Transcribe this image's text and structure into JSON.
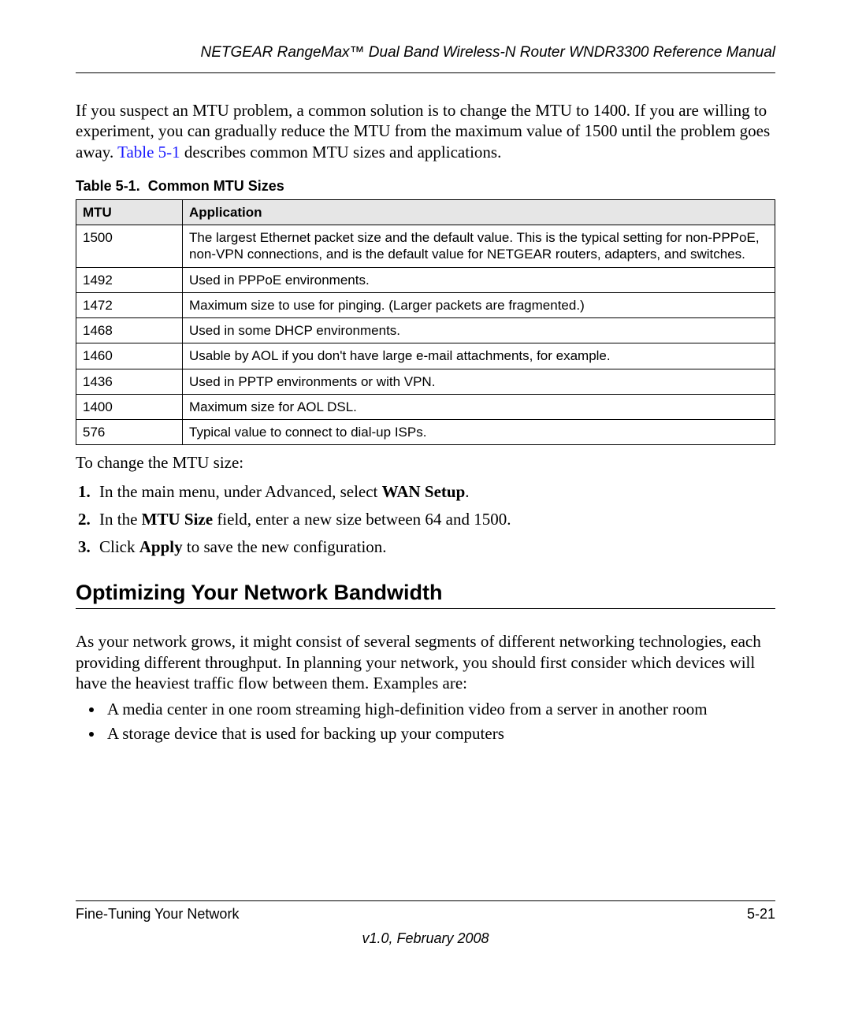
{
  "header": {
    "title": "NETGEAR RangeMax™ Dual Band Wireless-N Router WNDR3300 Reference Manual"
  },
  "intro": {
    "text_before_link": "If you suspect an MTU problem, a common solution is to change the MTU to 1400. If you are willing to experiment, you can gradually reduce the MTU from the maximum value of 1500 until the problem goes away. ",
    "link_text": "Table 5-1",
    "text_after_link": " describes common MTU sizes and applications."
  },
  "table": {
    "caption_label": "Table 5-1.",
    "caption_title": "Common MTU Sizes",
    "headers": {
      "mtu": "MTU",
      "app": "Application"
    },
    "rows": [
      {
        "mtu": "1500",
        "app": "The largest Ethernet packet size and the default value. This is the typical setting for non-PPPoE, non-VPN connections, and is the default value for NETGEAR routers, adapters, and switches."
      },
      {
        "mtu": "1492",
        "app": "Used in PPPoE environments."
      },
      {
        "mtu": "1472",
        "app": "Maximum size to use for pinging. (Larger packets are fragmented.)"
      },
      {
        "mtu": "1468",
        "app": "Used in some DHCP environments."
      },
      {
        "mtu": "1460",
        "app": "Usable by AOL if you don't have large e-mail attachments, for example."
      },
      {
        "mtu": "1436",
        "app": "Used in PPTP environments or with VPN."
      },
      {
        "mtu": "1400",
        "app": "Maximum size for AOL DSL."
      },
      {
        "mtu": "576",
        "app": "Typical value to connect to dial-up ISPs."
      }
    ]
  },
  "after_table_line": "To change the MTU size:",
  "steps": {
    "s1_a": "In the main menu, under Advanced, select ",
    "s1_bold": "WAN Setup",
    "s1_b": ".",
    "s2_a": "In the ",
    "s2_bold": "MTU Size",
    "s2_b": " field, enter a new size between 64 and 1500.",
    "s3_a": "Click ",
    "s3_bold": "Apply",
    "s3_b": " to save the new configuration."
  },
  "section": {
    "heading": "Optimizing Your Network Bandwidth",
    "para": "As your network grows, it might consist of several segments of different networking technologies, each providing different throughput. In planning your network, you should first consider which devices will have the heaviest traffic flow between them. Examples are:",
    "bullets": [
      "A media center in one room streaming high-definition video from a server in another room",
      "A storage device that is used for backing up your computers"
    ]
  },
  "footer": {
    "left": "Fine-Tuning Your Network",
    "right": "5-21",
    "version": "v1.0, February 2008"
  }
}
